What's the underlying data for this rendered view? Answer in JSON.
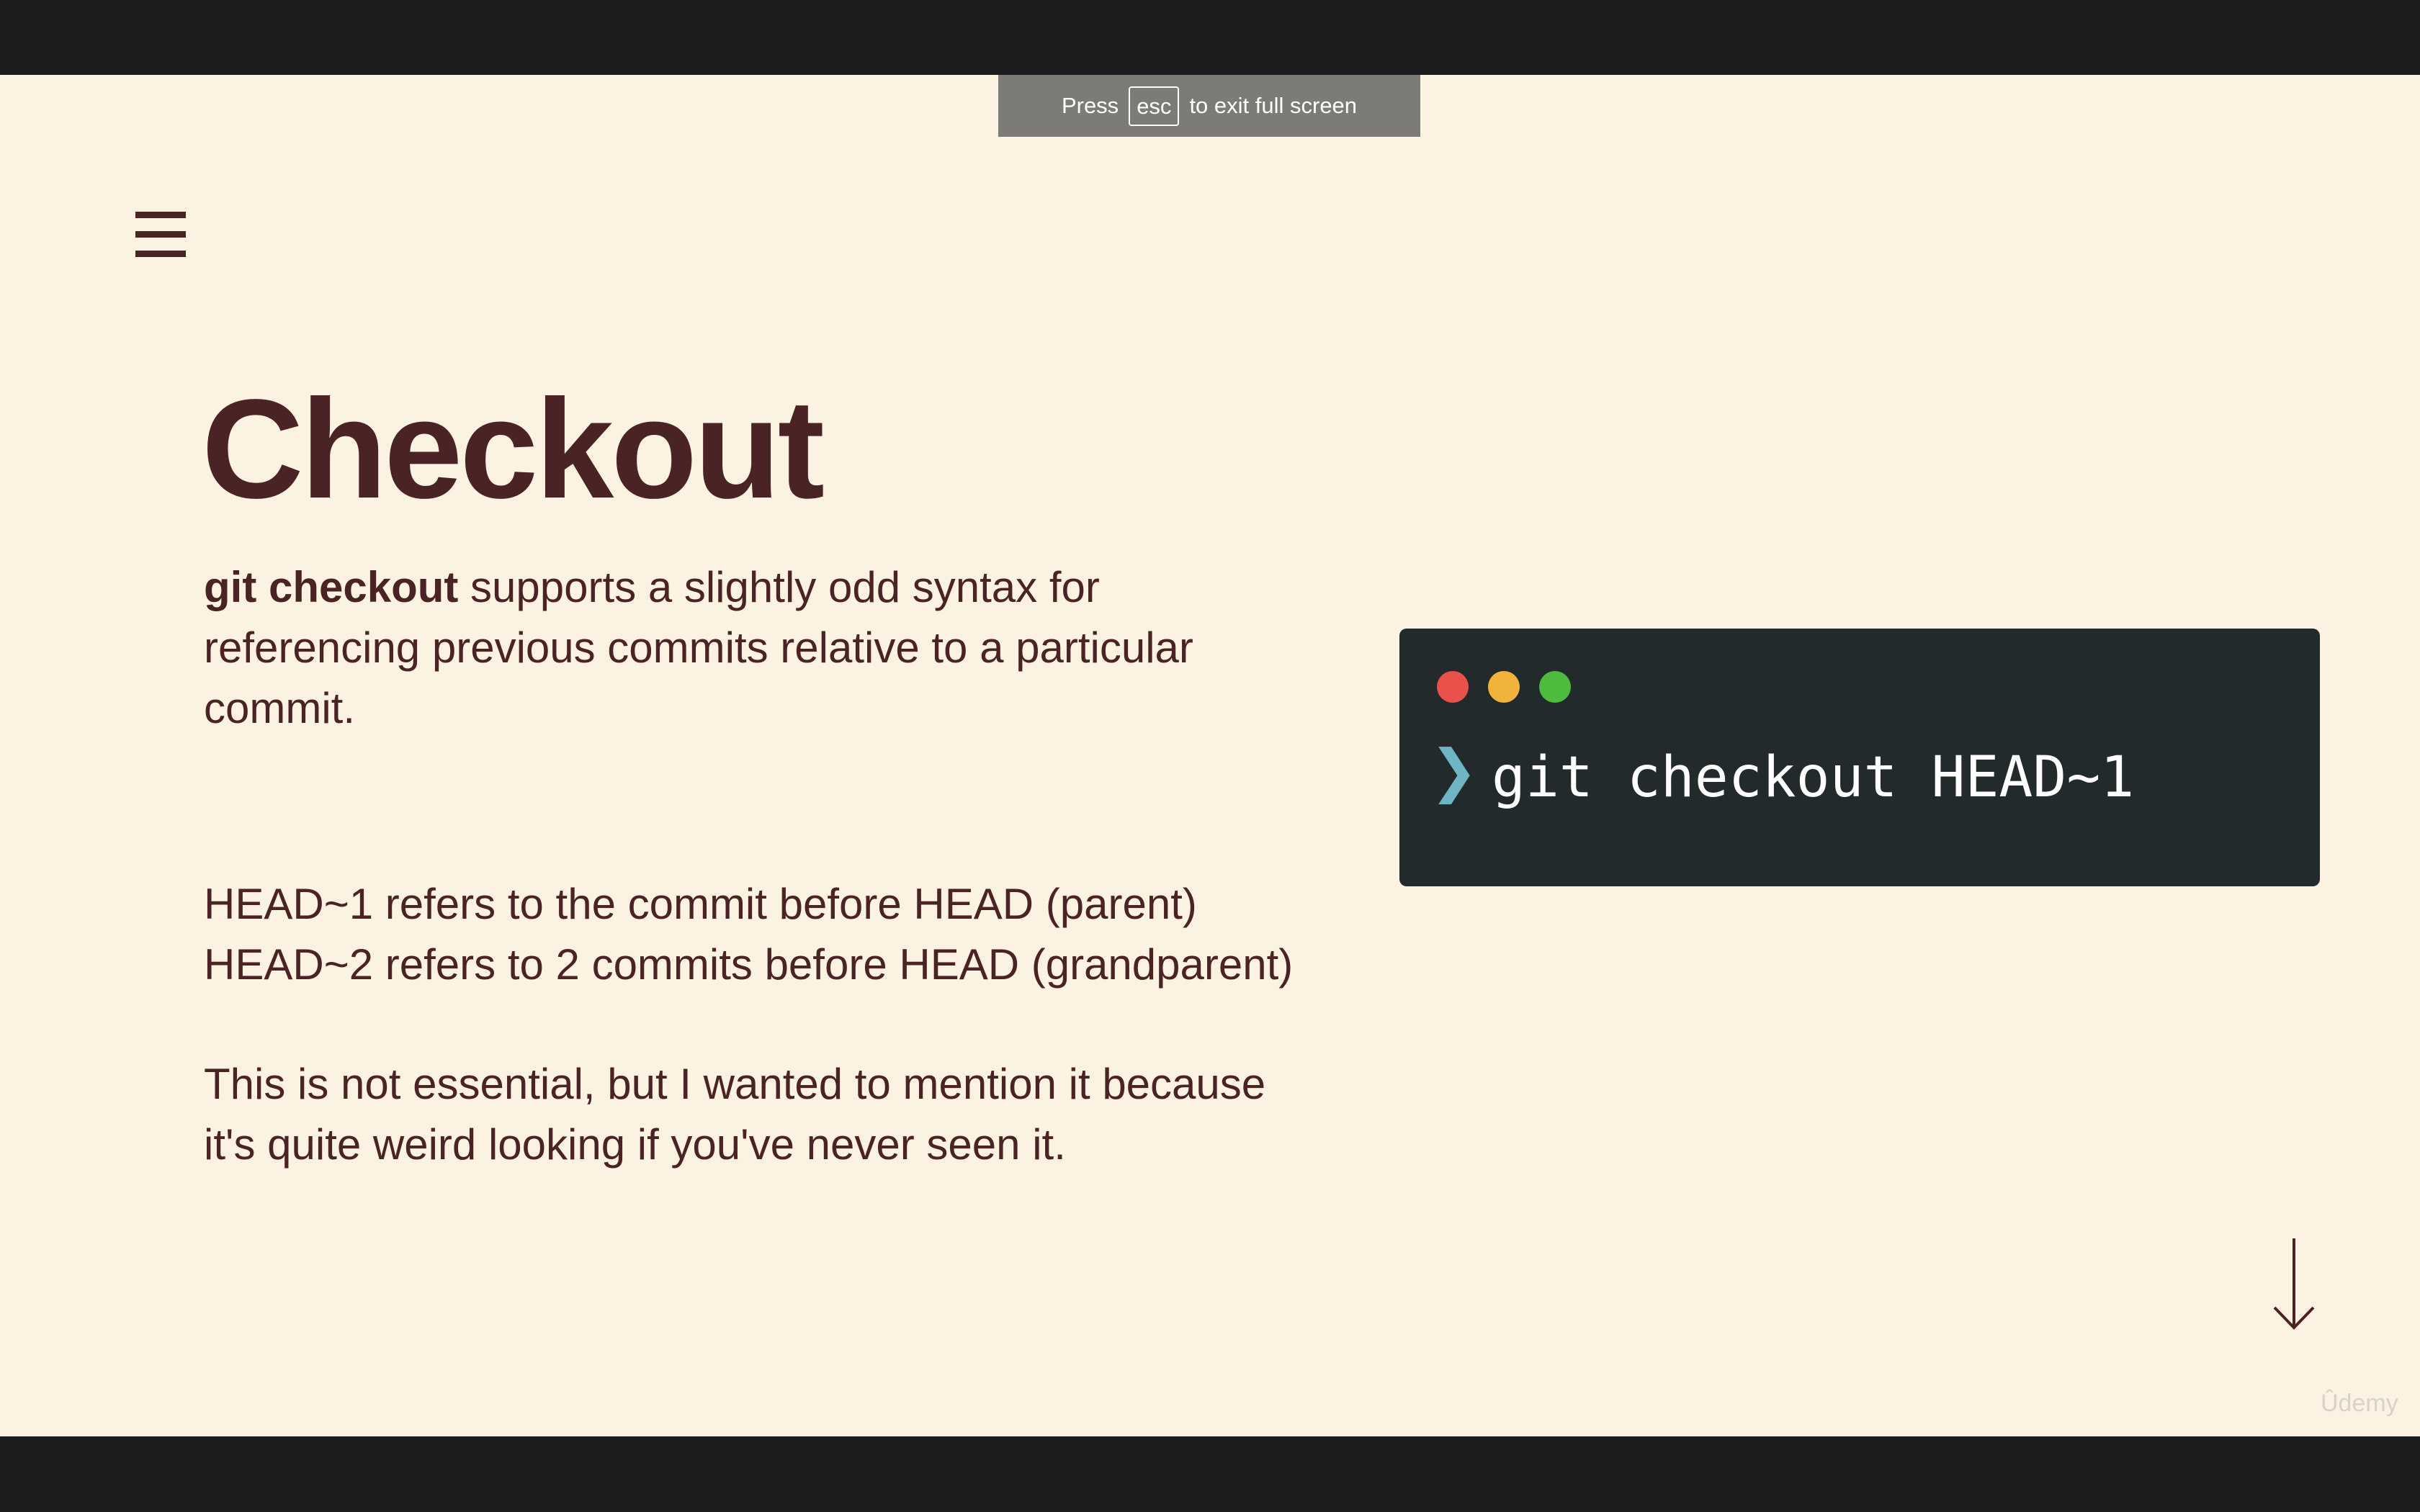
{
  "fullscreen_banner": {
    "prefix": "Press",
    "key": "esc",
    "suffix": "to exit full screen"
  },
  "slide": {
    "title": "Checkout",
    "paragraph1": {
      "bold": "git checkout",
      "rest": " supports a slightly odd syntax for referencing previous commits relative to a particular commit."
    },
    "paragraph2": {
      "line1": "HEAD~1 refers to the commit before HEAD (parent)",
      "line2": "HEAD~2 refers to 2 commits before HEAD (grandparent)"
    },
    "paragraph3": "This is not essential, but I wanted to mention it because it's quite weird looking if you've never seen it."
  },
  "terminal": {
    "prompt_symbol": "❯",
    "command": "git checkout HEAD~1"
  },
  "watermark": "Ûdemy",
  "icons": {
    "menu": "hamburger-menu-icon",
    "next": "down-arrow-icon"
  },
  "colors": {
    "background": "#fcf2e2",
    "text": "#4a2424",
    "terminal_bg": "#222a2c",
    "prompt": "#6fb6c4",
    "dot_red": "#e9514a",
    "dot_yellow": "#f2b33d",
    "dot_green": "#4dbb3d"
  }
}
